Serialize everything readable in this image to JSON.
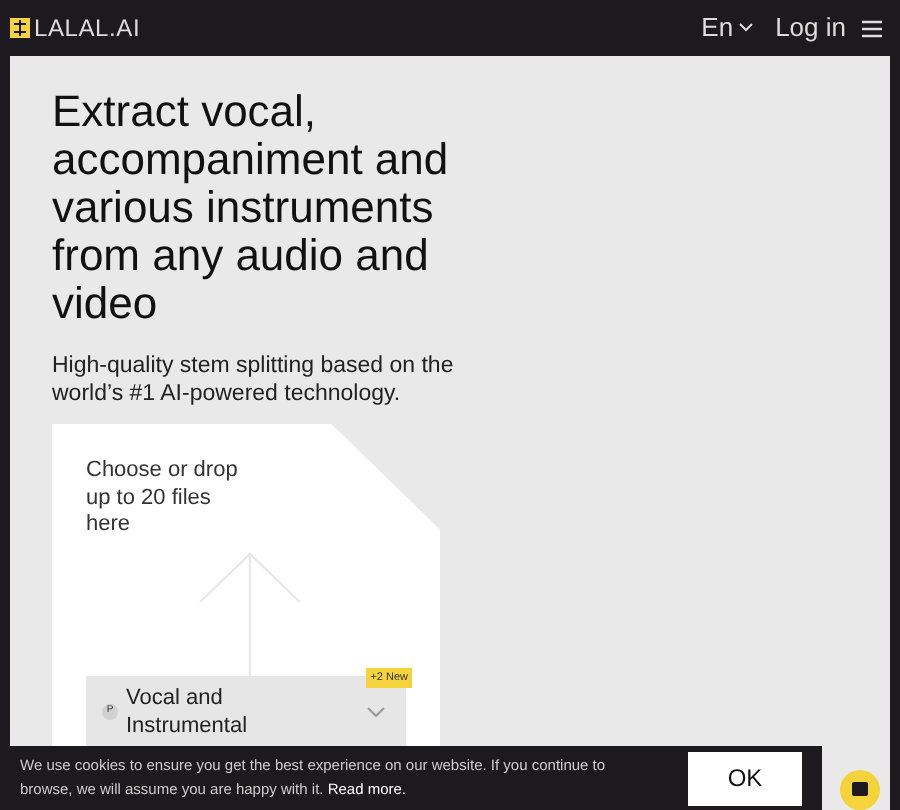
{
  "header": {
    "logo": "LALAL.AI",
    "language": "En",
    "login": "Log in"
  },
  "hero": {
    "title": "Extract vocal, accompaniment and various instruments from any audio and video",
    "subtitle": "High-quality stem splitting based on the world’s #1 AI-powered technology."
  },
  "upload": {
    "prompt": "Choose or drop up to 20 files here",
    "mode": {
      "badge": "P",
      "label": "Vocal and Instrumental",
      "new_badge": "+2 New"
    }
  },
  "cookie": {
    "text": "We use cookies to ensure you get the best experience on our website. If you continue to browse, we will assume you are happy with it. ",
    "link": "Read more.",
    "button": "OK"
  }
}
